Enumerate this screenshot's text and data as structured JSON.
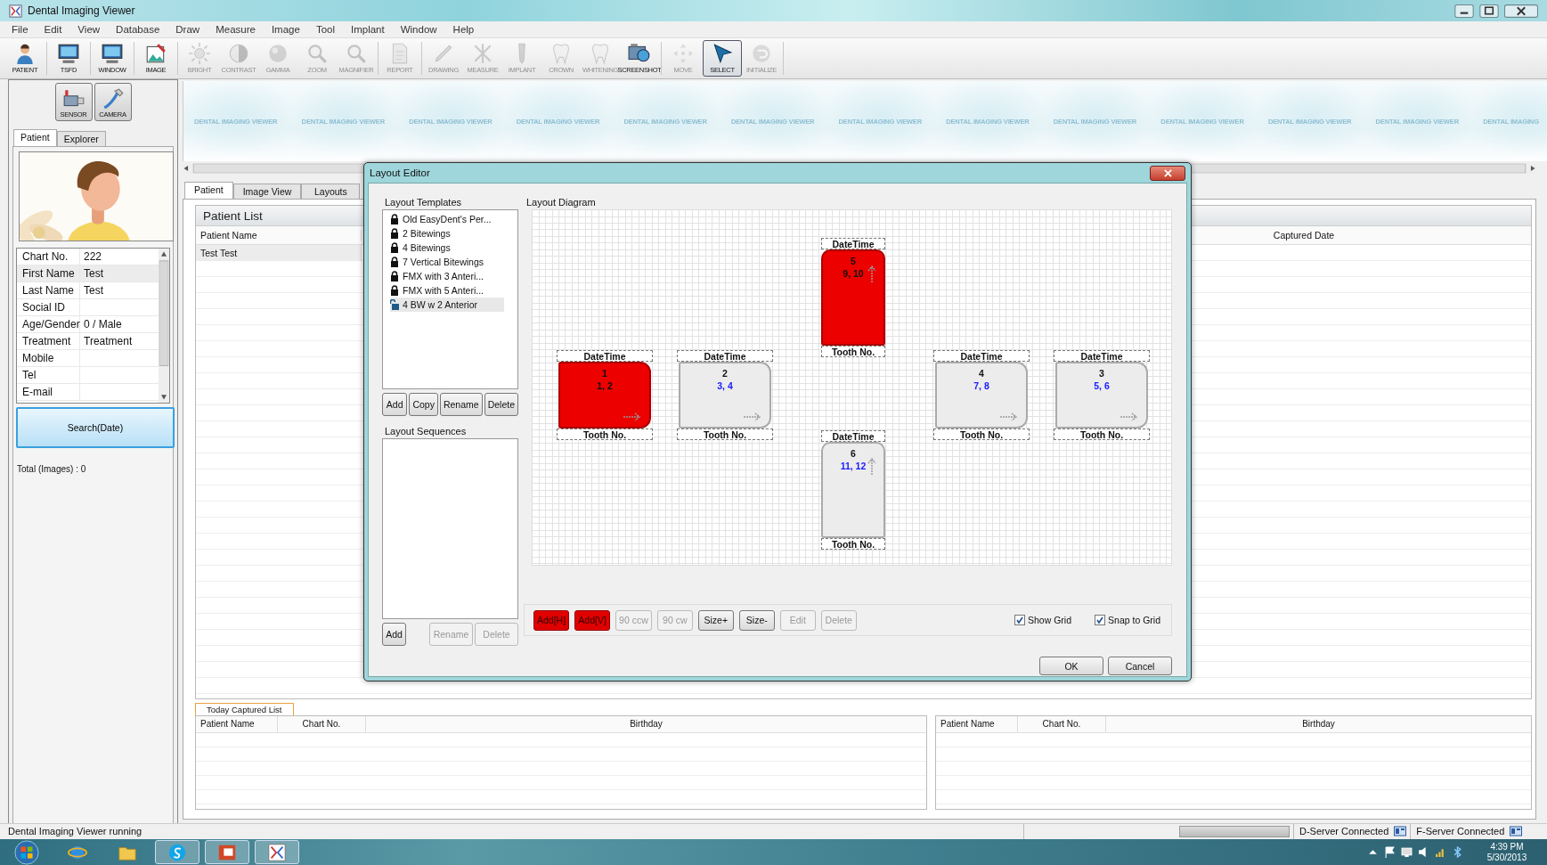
{
  "window": {
    "title": "Dental Imaging Viewer"
  },
  "menu": [
    "File",
    "Edit",
    "View",
    "Database",
    "Draw",
    "Measure",
    "Image",
    "Tool",
    "Implant",
    "Window",
    "Help"
  ],
  "toolbar": {
    "groups": [
      [
        {
          "label": "PATIENT",
          "disabled": false,
          "selected": false
        }
      ],
      [
        {
          "label": "TSFD",
          "disabled": false,
          "selected": false
        }
      ],
      [
        {
          "label": "WINDOW",
          "disabled": false,
          "selected": false
        }
      ],
      [
        {
          "label": "IMAGE",
          "disabled": false,
          "selected": false
        }
      ],
      [
        {
          "label": "BRIGHT",
          "disabled": true,
          "selected": false
        },
        {
          "label": "CONTRAST",
          "disabled": true,
          "selected": false
        },
        {
          "label": "GAMMA",
          "disabled": true,
          "selected": false
        },
        {
          "label": "ZOOM",
          "disabled": true,
          "selected": false
        },
        {
          "label": "MAGNIFIER",
          "disabled": true,
          "selected": false
        }
      ],
      [
        {
          "label": "REPORT",
          "disabled": true,
          "selected": false
        }
      ],
      [
        {
          "label": "DRAWING",
          "disabled": true,
          "selected": false
        },
        {
          "label": "MEASURE",
          "disabled": true,
          "selected": false
        },
        {
          "label": "IMPLANT",
          "disabled": true,
          "selected": false
        },
        {
          "label": "CROWN",
          "disabled": true,
          "selected": false
        },
        {
          "label": "WHITENING",
          "disabled": true,
          "selected": false
        },
        {
          "label": "SCREENSHOT",
          "disabled": false,
          "selected": false
        }
      ],
      [
        {
          "label": "MOVE",
          "disabled": true,
          "selected": false
        },
        {
          "label": "SELECT",
          "disabled": false,
          "selected": true
        },
        {
          "label": "INITIALIZE",
          "disabled": true,
          "selected": false
        }
      ]
    ]
  },
  "device_buttons": [
    "SENSOR",
    "CAMERA"
  ],
  "side_tabs": [
    {
      "label": "Patient",
      "selected": true
    },
    {
      "label": "Explorer",
      "selected": false
    }
  ],
  "patient_info": [
    {
      "label": "Chart No.",
      "value": "222",
      "selected": false
    },
    {
      "label": "First Name",
      "value": "Test",
      "selected": true
    },
    {
      "label": "Last Name",
      "value": "Test",
      "selected": false
    },
    {
      "label": "Social ID",
      "selected": false
    },
    {
      "label": "Age/Gender",
      "value": "0 / Male",
      "selected": false
    },
    {
      "label": "Treatment",
      "value": "Treatment",
      "selected": false
    },
    {
      "label": "Mobile",
      "selected": false
    },
    {
      "label": "Tel",
      "selected": false
    },
    {
      "label": "E-mail",
      "selected": false
    }
  ],
  "search_button": "Search(Date)",
  "total": "Total (Images) : 0",
  "banner": [
    "DENTAL IMAGING VIEWER",
    "DENTAL IMAGING VIEWER",
    "DENTAL IMAGING VIEWER",
    "DENTAL IMAGING VIEWER",
    "DENTAL IMAGING VIEWER",
    "DENTAL IMAGING VIEWER",
    "DENTAL IMAGING VIEWER",
    "DENTAL IMAGING VIEWER",
    "DENTAL IMAGING VIEWER",
    "DENTAL IMAGING VIEWER",
    "DENTAL IMAGING VIEWER",
    "DENTAL IMAGING VIEWER",
    "DENTAL IMAGING"
  ],
  "main_tabs": [
    {
      "label": "Patient",
      "selected": true
    },
    {
      "label": "Image View",
      "selected": false
    },
    {
      "label": "Layouts",
      "selected": false
    }
  ],
  "patient_list": {
    "title": "Patient List",
    "columns": [
      "Patient Name",
      "Captured Date"
    ],
    "rows": [
      {
        "patient_name": "Test Test",
        "selected": true
      }
    ]
  },
  "today_tab": "Today Captured List",
  "today_tables": [
    {
      "columns": [
        "Patient Name",
        "Chart No.",
        "Birthday"
      ]
    },
    {
      "columns": [
        "Patient Name",
        "Chart No.",
        "Birthday"
      ]
    }
  ],
  "dialog": {
    "title": "Layout Editor",
    "templates": {
      "label": "Layout Templates",
      "items": [
        {
          "name": "Old EasyDent's Per...",
          "locked": true,
          "selected": false
        },
        {
          "name": "2 Bitewings",
          "locked": true,
          "selected": false
        },
        {
          "name": "4 Bitewings",
          "locked": true,
          "selected": false
        },
        {
          "name": "7 Vertical Bitewings",
          "locked": true,
          "selected": false
        },
        {
          "name": "FMX with 3 Anteri...",
          "locked": true,
          "selected": false
        },
        {
          "name": "FMX with 5 Anteri...",
          "locked": true,
          "selected": false
        },
        {
          "name": "4 BW w 2 Anterior",
          "locked": false,
          "selected": true
        }
      ],
      "buttons": [
        {
          "label": "Add",
          "disabled": false
        },
        {
          "label": "Copy",
          "disabled": false
        },
        {
          "label": "Rename",
          "disabled": false
        },
        {
          "label": "Delete",
          "disabled": false
        }
      ]
    },
    "sequences": {
      "label": "Layout Sequences",
      "buttons": [
        {
          "label": "Add",
          "disabled": false
        },
        {
          "label": "Rename",
          "disabled": true
        },
        {
          "label": "Delete",
          "disabled": true
        }
      ]
    },
    "diagram": {
      "label": "Layout Diagram",
      "slots": [
        {
          "number": "5",
          "teeth": "9, 10",
          "kind": "vertical",
          "selected": true,
          "header": "DateTime",
          "footer": "Tooth No."
        },
        {
          "number": "1",
          "teeth": "1, 2",
          "kind": "horizontal",
          "selected": true,
          "header": "DateTime",
          "footer": "Tooth No."
        },
        {
          "number": "2",
          "teeth": "3, 4",
          "kind": "horizontal",
          "selected": false,
          "header": "DateTime",
          "footer": "Tooth No."
        },
        {
          "number": "4",
          "teeth": "7, 8",
          "kind": "horizontal",
          "selected": false,
          "header": "DateTime",
          "footer": "Tooth No."
        },
        {
          "number": "3",
          "teeth": "5, 6",
          "kind": "horizontal",
          "selected": false,
          "header": "DateTime",
          "footer": "Tooth No."
        },
        {
          "number": "6",
          "teeth": "11, 12",
          "kind": "vertical",
          "selected": false,
          "header": "DateTime",
          "footer": "Tooth No."
        }
      ],
      "buttons": [
        {
          "label": "Add[H]",
          "kind": "accent",
          "disabled": false
        },
        {
          "label": "Add[V]",
          "kind": "accent",
          "disabled": false
        },
        {
          "label": "90 ccw",
          "kind": "normal",
          "disabled": true
        },
        {
          "label": "90 cw",
          "kind": "normal",
          "disabled": true
        },
        {
          "label": "Size+",
          "kind": "normal",
          "disabled": false
        },
        {
          "label": "Size-",
          "kind": "normal",
          "disabled": false
        },
        {
          "label": "Edit",
          "kind": "normal",
          "disabled": true
        },
        {
          "label": "Delete",
          "kind": "normal",
          "disabled": true
        }
      ],
      "options": [
        {
          "label": "Show Grid",
          "checked": true
        },
        {
          "label": "Snap to Grid",
          "checked": true
        }
      ]
    },
    "buttons": [
      "OK",
      "Cancel"
    ]
  },
  "status_bar": {
    "message": "Dental Imaging Viewer running",
    "servers": [
      "D-Server Connected",
      "F-Server Connected"
    ]
  },
  "taskbar": {
    "apps": [
      {
        "open": false
      },
      {
        "open": false
      },
      {
        "open": true
      },
      {
        "open": true
      },
      {
        "open": true
      }
    ],
    "time": "4:39 PM",
    "date": "5/30/2013"
  }
}
